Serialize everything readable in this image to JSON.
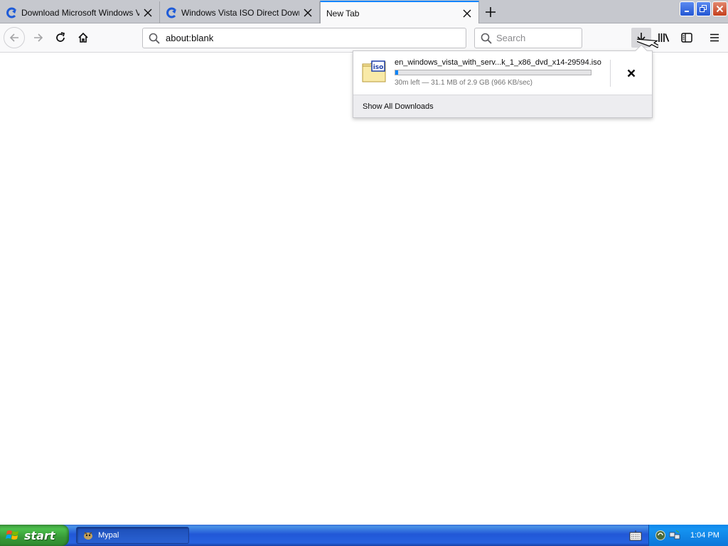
{
  "browser": {
    "tabs": [
      {
        "title": "Download Microsoft Windows Vista",
        "active": false
      },
      {
        "title": "Windows Vista ISO Direct Download",
        "active": false
      },
      {
        "title": "New Tab",
        "active": true
      }
    ],
    "url": "about:blank",
    "search_placeholder": "Search"
  },
  "downloads_panel": {
    "file_name": "en_windows_vista_with_serv...k_1_x86_dvd_x14-29594.iso",
    "progress_fraction": 0.011,
    "status": "30m left — 31.1 MB of 2.9 GB (966 KB/sec)",
    "icon_label": "iso",
    "footer_label": "Show All Downloads"
  },
  "taskbar": {
    "start_label": "start",
    "items": [
      {
        "label": "Mypal"
      }
    ],
    "clock": "1:04 PM"
  },
  "colors": {
    "accent": "#0a84ff",
    "taskbar_blue": "#2157d7",
    "start_green": "#379937"
  }
}
